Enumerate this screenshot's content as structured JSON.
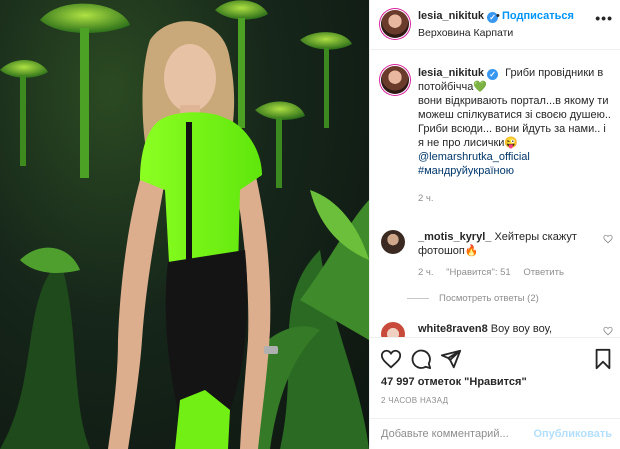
{
  "header": {
    "username": "lesia_nikituk",
    "separator": "•",
    "follow_label": "Подписаться",
    "location": "Верховина Карпати",
    "more_label": "•••"
  },
  "caption": {
    "username": "lesia_nikituk",
    "line1": "Гриби провідники в потойбічча",
    "emoji1": "💚",
    "line2": "вони відкривають портал...в якому ти можеш спілкуватися зі своєю душею..",
    "line3": "Гриби всюди... вони йдуть за нами.. і я не про лисички",
    "emoji2": "😜",
    "mention": "@lemarshrutka_official",
    "hashtag": "#мандруйукраїною",
    "time": "2 ч."
  },
  "comments": [
    {
      "username": "_motis_kyryl_",
      "text": "Хейтеры скажут фотошоп",
      "emoji": "🔥",
      "time": "2 ч.",
      "likes": "\"Нравится\": 51",
      "reply": "Ответить",
      "view_replies": "Посмотреть ответы (2)"
    },
    {
      "username": "white8raven8",
      "text": "Воу воу воу,"
    }
  ],
  "actions": {
    "like_icon": "heart-icon",
    "comment_icon": "comment-icon",
    "share_icon": "share-icon",
    "save_icon": "bookmark-icon",
    "likes_text": "47 997 отметок \"Нравится\"",
    "time_ago": "2 ЧАСОВ НАЗАД",
    "add_comment_placeholder": "Добавьте комментарий...",
    "publish_label": "Опубликовать"
  },
  "colors": {
    "accent": "#0095f6",
    "verified": "#3897f0",
    "muted": "#8e8e8e",
    "neon": "#7dff1a"
  }
}
